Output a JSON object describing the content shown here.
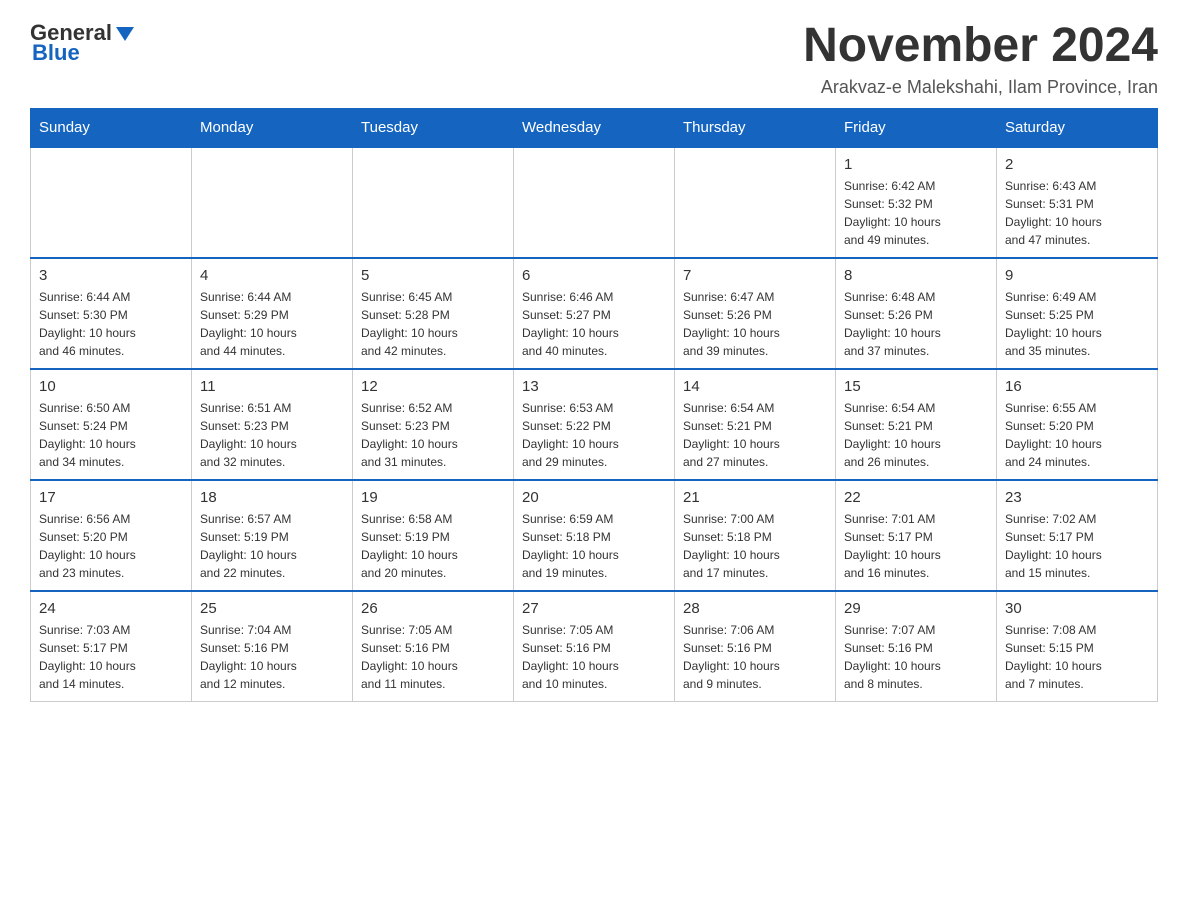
{
  "header": {
    "logo_general": "General",
    "logo_blue": "Blue",
    "title": "November 2024",
    "subtitle": "Arakvaz-e Malekshahi, Ilam Province, Iran"
  },
  "days_of_week": [
    "Sunday",
    "Monday",
    "Tuesday",
    "Wednesday",
    "Thursday",
    "Friday",
    "Saturday"
  ],
  "weeks": [
    {
      "days": [
        {
          "num": "",
          "info": ""
        },
        {
          "num": "",
          "info": ""
        },
        {
          "num": "",
          "info": ""
        },
        {
          "num": "",
          "info": ""
        },
        {
          "num": "",
          "info": ""
        },
        {
          "num": "1",
          "info": "Sunrise: 6:42 AM\nSunset: 5:32 PM\nDaylight: 10 hours\nand 49 minutes."
        },
        {
          "num": "2",
          "info": "Sunrise: 6:43 AM\nSunset: 5:31 PM\nDaylight: 10 hours\nand 47 minutes."
        }
      ]
    },
    {
      "days": [
        {
          "num": "3",
          "info": "Sunrise: 6:44 AM\nSunset: 5:30 PM\nDaylight: 10 hours\nand 46 minutes."
        },
        {
          "num": "4",
          "info": "Sunrise: 6:44 AM\nSunset: 5:29 PM\nDaylight: 10 hours\nand 44 minutes."
        },
        {
          "num": "5",
          "info": "Sunrise: 6:45 AM\nSunset: 5:28 PM\nDaylight: 10 hours\nand 42 minutes."
        },
        {
          "num": "6",
          "info": "Sunrise: 6:46 AM\nSunset: 5:27 PM\nDaylight: 10 hours\nand 40 minutes."
        },
        {
          "num": "7",
          "info": "Sunrise: 6:47 AM\nSunset: 5:26 PM\nDaylight: 10 hours\nand 39 minutes."
        },
        {
          "num": "8",
          "info": "Sunrise: 6:48 AM\nSunset: 5:26 PM\nDaylight: 10 hours\nand 37 minutes."
        },
        {
          "num": "9",
          "info": "Sunrise: 6:49 AM\nSunset: 5:25 PM\nDaylight: 10 hours\nand 35 minutes."
        }
      ]
    },
    {
      "days": [
        {
          "num": "10",
          "info": "Sunrise: 6:50 AM\nSunset: 5:24 PM\nDaylight: 10 hours\nand 34 minutes."
        },
        {
          "num": "11",
          "info": "Sunrise: 6:51 AM\nSunset: 5:23 PM\nDaylight: 10 hours\nand 32 minutes."
        },
        {
          "num": "12",
          "info": "Sunrise: 6:52 AM\nSunset: 5:23 PM\nDaylight: 10 hours\nand 31 minutes."
        },
        {
          "num": "13",
          "info": "Sunrise: 6:53 AM\nSunset: 5:22 PM\nDaylight: 10 hours\nand 29 minutes."
        },
        {
          "num": "14",
          "info": "Sunrise: 6:54 AM\nSunset: 5:21 PM\nDaylight: 10 hours\nand 27 minutes."
        },
        {
          "num": "15",
          "info": "Sunrise: 6:54 AM\nSunset: 5:21 PM\nDaylight: 10 hours\nand 26 minutes."
        },
        {
          "num": "16",
          "info": "Sunrise: 6:55 AM\nSunset: 5:20 PM\nDaylight: 10 hours\nand 24 minutes."
        }
      ]
    },
    {
      "days": [
        {
          "num": "17",
          "info": "Sunrise: 6:56 AM\nSunset: 5:20 PM\nDaylight: 10 hours\nand 23 minutes."
        },
        {
          "num": "18",
          "info": "Sunrise: 6:57 AM\nSunset: 5:19 PM\nDaylight: 10 hours\nand 22 minutes."
        },
        {
          "num": "19",
          "info": "Sunrise: 6:58 AM\nSunset: 5:19 PM\nDaylight: 10 hours\nand 20 minutes."
        },
        {
          "num": "20",
          "info": "Sunrise: 6:59 AM\nSunset: 5:18 PM\nDaylight: 10 hours\nand 19 minutes."
        },
        {
          "num": "21",
          "info": "Sunrise: 7:00 AM\nSunset: 5:18 PM\nDaylight: 10 hours\nand 17 minutes."
        },
        {
          "num": "22",
          "info": "Sunrise: 7:01 AM\nSunset: 5:17 PM\nDaylight: 10 hours\nand 16 minutes."
        },
        {
          "num": "23",
          "info": "Sunrise: 7:02 AM\nSunset: 5:17 PM\nDaylight: 10 hours\nand 15 minutes."
        }
      ]
    },
    {
      "days": [
        {
          "num": "24",
          "info": "Sunrise: 7:03 AM\nSunset: 5:17 PM\nDaylight: 10 hours\nand 14 minutes."
        },
        {
          "num": "25",
          "info": "Sunrise: 7:04 AM\nSunset: 5:16 PM\nDaylight: 10 hours\nand 12 minutes."
        },
        {
          "num": "26",
          "info": "Sunrise: 7:05 AM\nSunset: 5:16 PM\nDaylight: 10 hours\nand 11 minutes."
        },
        {
          "num": "27",
          "info": "Sunrise: 7:05 AM\nSunset: 5:16 PM\nDaylight: 10 hours\nand 10 minutes."
        },
        {
          "num": "28",
          "info": "Sunrise: 7:06 AM\nSunset: 5:16 PM\nDaylight: 10 hours\nand 9 minutes."
        },
        {
          "num": "29",
          "info": "Sunrise: 7:07 AM\nSunset: 5:16 PM\nDaylight: 10 hours\nand 8 minutes."
        },
        {
          "num": "30",
          "info": "Sunrise: 7:08 AM\nSunset: 5:15 PM\nDaylight: 10 hours\nand 7 minutes."
        }
      ]
    }
  ]
}
